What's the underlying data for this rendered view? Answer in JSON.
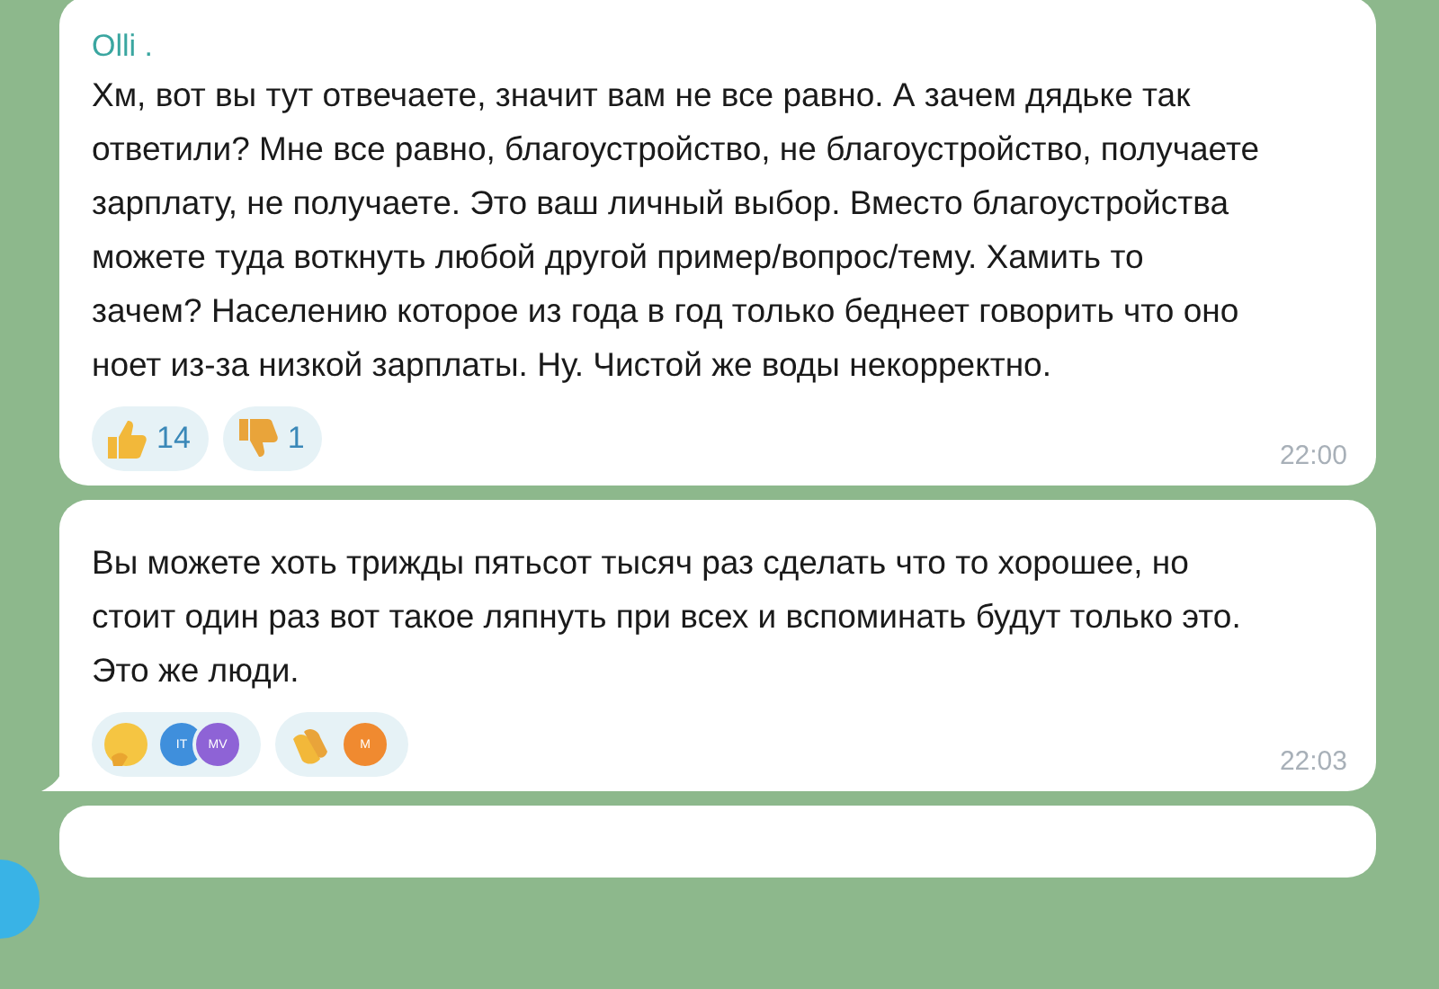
{
  "messages": [
    {
      "sender": "Olli .",
      "text": "Хм, вот вы тут отвечаете, значит вам не все равно. А зачем дядьке так ответили? Мне все равно, благоустройство, не благоустройство, получаете зарплату, не получаете. Это ваш личный выбор. Вместо благоустройства можете туда воткнуть любой другой пример/вопрос/тему. Хамить то зачем? Населению которое из года в год только беднеет говорить что оно ноет из-за низкой зарплаты. Ну. Чистой же воды некорректно.",
      "reactions": [
        {
          "kind": "like",
          "count": "14"
        },
        {
          "kind": "dislike",
          "count": "1"
        }
      ],
      "time": "22:00",
      "tail": false
    },
    {
      "text": "Вы можете хоть трижды пятьсот тысяч раз сделать что то хорошее, но стоит один раз вот такое ляпнуть при всех и вспоминать будут только это.\nЭто же люди.",
      "reactions": [
        {
          "kind": "thinking",
          "avatars": [
            {
              "initials": "IT",
              "color": "#3f8fdc"
            },
            {
              "initials": "MV",
              "color": "#8e63d6"
            }
          ]
        },
        {
          "kind": "clap",
          "avatars": [
            {
              "initials": "M",
              "color": "#f08a30"
            }
          ]
        }
      ],
      "time": "22:03",
      "tail": true
    }
  ]
}
